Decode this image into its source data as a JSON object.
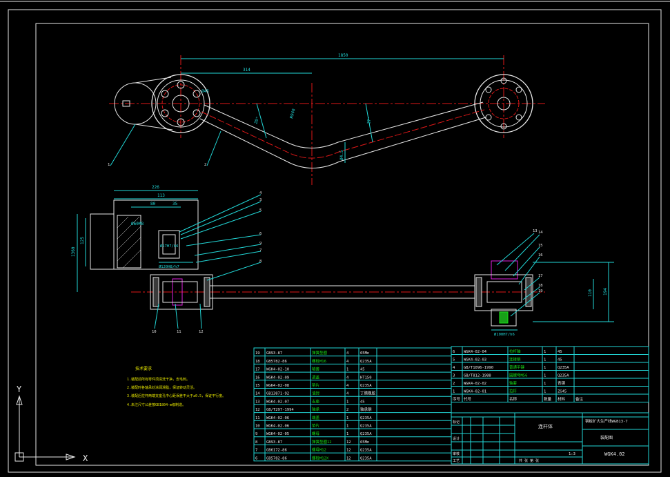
{
  "ucs": {
    "y_label": "Y",
    "x_label": "X"
  },
  "dimensions": {
    "top_overall": "1850",
    "top_partial": "314",
    "left_w1": "226",
    "left_w2": "113",
    "left_w3": "80",
    "left_w4": "35",
    "left_h1": "1360",
    "left_h2": "125",
    "right_h1": "110",
    "right_h2": "194",
    "dia_bottom_right": "Ø100H7/h6",
    "dia_bottom_left": "Ø120H8/h7",
    "dia_rod": "Ø60M8",
    "fit_left": "Ø57H7/h6",
    "angle_a": "20°",
    "angle_b": "9°",
    "angle_c": "27°",
    "angle_d": "R940",
    "dim_mid": "Ø4.5",
    "label_k": "Ø45"
  },
  "balloons": [
    "1",
    "2",
    "3",
    "4",
    "5",
    "6",
    "7",
    "8",
    "9",
    "10",
    "11",
    "12",
    "13",
    "14",
    "15",
    "16",
    "17",
    "18",
    "19"
  ],
  "tech_notes": {
    "title": "技术要求",
    "lines": [
      "1.装配前所有零件须清洗干净，去毛刺。",
      "2.装配时各轴承处涂润滑脂，保证转动灵活。",
      "3.装配后拉杆两端支座孔中心距误差不大于±0.5，保证平行度。",
      "4.未注尺寸公差按GB1804-m级制造。"
    ]
  },
  "bom_left": [
    {
      "no": "19",
      "code": "GB93-87",
      "name": "弹簧垫圈",
      "qty": "4",
      "mat": "65Mn"
    },
    {
      "no": "18",
      "code": "GB5782-86",
      "name": "螺栓M16",
      "qty": "4",
      "mat": "Q235A"
    },
    {
      "no": "17",
      "code": "WGK4-02-10",
      "name": "轴套",
      "qty": "1",
      "mat": "45"
    },
    {
      "no": "16",
      "code": "WGK4-02-09",
      "name": "透盖",
      "qty": "4",
      "mat": "HT150"
    },
    {
      "no": "15",
      "code": "WGK4-02-08",
      "name": "垫片",
      "qty": "4",
      "mat": "Q235A"
    },
    {
      "no": "14",
      "code": "GB13871-92",
      "name": "油封",
      "qty": "4",
      "mat": "丁腈橡胶"
    },
    {
      "no": "13",
      "code": "WGK4-02-07",
      "name": "支座",
      "qty": "1",
      "mat": "45"
    },
    {
      "no": "12",
      "code": "GB/T297-1994",
      "name": "轴承",
      "qty": "2",
      "mat": "轴承钢"
    },
    {
      "no": "11",
      "code": "WGK4-02-06",
      "name": "端盖",
      "qty": "1",
      "mat": "Q235A"
    },
    {
      "no": "10",
      "code": "WGK4-02-06",
      "name": "垫片",
      "qty": "1",
      "mat": "Q235A"
    },
    {
      "no": "9",
      "code": "WGK4-02-05",
      "name": "螺母",
      "qty": "1",
      "mat": "Q235A"
    },
    {
      "no": "8",
      "code": "GB93-87",
      "name": "弹簧垫圈12",
      "qty": "12",
      "mat": "65Mn"
    },
    {
      "no": "7",
      "code": "GB6172-86",
      "name": "螺母M12",
      "qty": "12",
      "mat": "Q235A"
    },
    {
      "no": "6",
      "code": "GB5782-86",
      "name": "螺栓M12X",
      "qty": "12",
      "mat": "Q235A"
    }
  ],
  "bom_right": [
    {
      "no": "6",
      "code": "WGK4-02-04",
      "name": "拉杆轴",
      "qty": "1",
      "mat": "45"
    },
    {
      "no": "5",
      "code": "WGK4-02-03",
      "name": "连接销",
      "qty": "1",
      "mat": "45"
    },
    {
      "no": "4",
      "code": "GB/T1096-1990",
      "name": "普通平键",
      "qty": "1",
      "mat": "Q235A"
    },
    {
      "no": "3",
      "code": "GB/T812-1988",
      "name": "圆螺母M56",
      "qty": "1",
      "mat": "Q235A"
    },
    {
      "no": "2",
      "code": "WGK4-02-02",
      "name": "轴套",
      "qty": "1",
      "mat": "青铜"
    },
    {
      "no": "1",
      "code": "WGK4-02-01",
      "name": "拉杆",
      "qty": "1",
      "mat": "ZG45"
    }
  ],
  "bom_header": {
    "no": "序号",
    "code": "代号",
    "name": "名称",
    "qty": "数量",
    "mat": "材料",
    "remark": "备注",
    "w1": "单件",
    "w2": "总计",
    "weight": "重量"
  },
  "title_block": {
    "assembly": "连杆体",
    "project": "钢板扩大生产线WGB13-7",
    "drawing_type": "装配图",
    "drawing_no": "WGK4.02",
    "scale": "1:3",
    "sheet": "共 张 第 张",
    "row_a": "标记",
    "row_b": "设计",
    "row_c": "审核",
    "row_d": "工艺"
  },
  "colors": {
    "cyan": "#22d8d8",
    "green": "#18e018",
    "red": "#e01818",
    "white": "#e8e8e8",
    "yellow": "#e8e800",
    "magenta": "#e020e0"
  }
}
